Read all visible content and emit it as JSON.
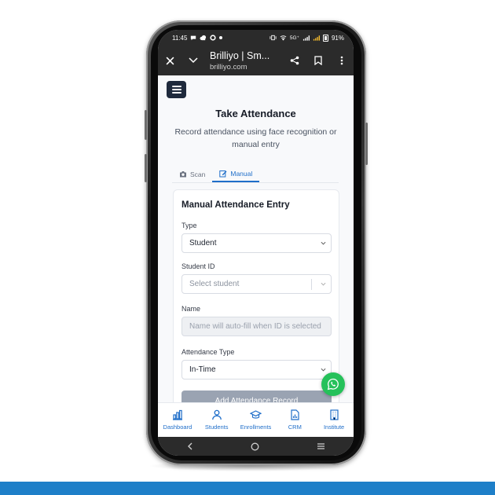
{
  "status_bar": {
    "time": "11:45",
    "signal_text": "5G⁺",
    "battery": "91%"
  },
  "browser": {
    "title": "Brilliyo | Sm...",
    "domain": "brilliyo.com"
  },
  "page": {
    "title": "Take Attendance",
    "subtitle": "Record attendance using face recognition or manual entry"
  },
  "tabs": [
    {
      "label": "Scan",
      "active": false
    },
    {
      "label": "Manual",
      "active": true
    }
  ],
  "form": {
    "title": "Manual Attendance Entry",
    "type_label": "Type",
    "type_value": "Student",
    "student_id_label": "Student ID",
    "student_id_placeholder": "Select student",
    "name_label": "Name",
    "name_placeholder": "Name will auto-fill when ID is selected",
    "attendance_type_label": "Attendance Type",
    "attendance_type_value": "In-Time",
    "submit_label": "Add Attendance Record"
  },
  "bottom_nav": [
    {
      "label": "Dashboard",
      "icon": "bar-chart-icon"
    },
    {
      "label": "Students",
      "icon": "user-icon"
    },
    {
      "label": "Enrollments",
      "icon": "graduation-cap-icon"
    },
    {
      "label": "CRM",
      "icon": "document-chart-icon"
    },
    {
      "label": "Institute",
      "icon": "building-icon"
    }
  ],
  "colors": {
    "accent": "#1f6ec9",
    "whatsapp": "#25c15a",
    "bottom_bar": "#1e7fc8"
  }
}
